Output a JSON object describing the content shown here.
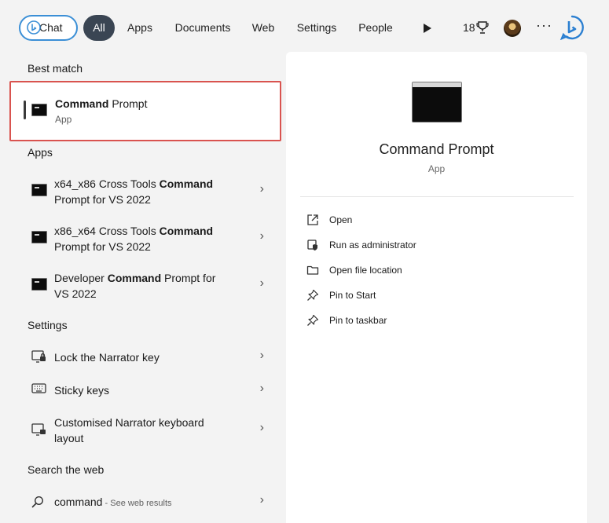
{
  "filters": {
    "chat": "Chat",
    "all": "All",
    "apps": "Apps",
    "documents": "Documents",
    "web": "Web",
    "settings": "Settings",
    "people": "People",
    "rewards_count": "18",
    "more": "···"
  },
  "sections": {
    "best_match": "Best match",
    "apps": "Apps",
    "settings": "Settings",
    "web": "Search the web"
  },
  "best_match": {
    "title_bold": "Command",
    "title_rest": " Prompt",
    "subtitle": "App"
  },
  "apps": [
    {
      "pre": "x64_x86 Cross Tools ",
      "bold": "Command",
      "post": "",
      "line2": "Prompt for VS 2022"
    },
    {
      "pre": "x86_x64 Cross Tools ",
      "bold": "Command",
      "post": "",
      "line2": "Prompt for VS 2022"
    },
    {
      "pre": "Developer ",
      "bold": "Command",
      "post": " Prompt for",
      "line2": "VS 2022"
    }
  ],
  "settings": [
    {
      "label": "Lock the Narrator key"
    },
    {
      "label": "Sticky keys"
    },
    {
      "label_line1": "Customised Narrator keyboard",
      "label_line2": "layout"
    }
  ],
  "web": {
    "query": "command",
    "hint": " - See web results"
  },
  "preview": {
    "title": "Command Prompt",
    "subtitle": "App",
    "actions": [
      {
        "label": "Open",
        "icon": "open-external-icon"
      },
      {
        "label": "Run as administrator",
        "icon": "shield-icon"
      },
      {
        "label": "Open file location",
        "icon": "folder-icon"
      },
      {
        "label": "Pin to Start",
        "icon": "pin-icon"
      },
      {
        "label": "Pin to taskbar",
        "icon": "pin-icon"
      }
    ]
  },
  "colors": {
    "accent": "#3b8fd6",
    "selected_pill": "#3a4553",
    "highlight_border": "#d9534f"
  }
}
